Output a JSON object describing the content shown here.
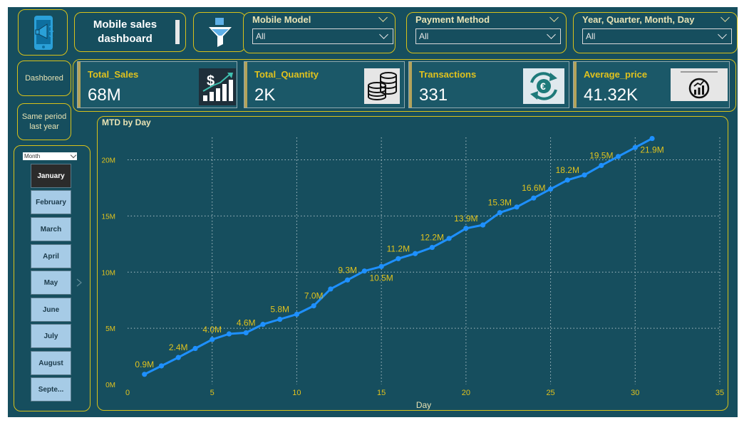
{
  "header": {
    "title": "Mobile sales dashboard",
    "slicers": [
      {
        "label": "Mobile Model",
        "value": "All"
      },
      {
        "label": "Payment Method",
        "value": "All"
      },
      {
        "label": "Year, Quarter, Month, Day",
        "value": "All"
      }
    ]
  },
  "nav": {
    "dashboard": "Dashbored",
    "same_period": "Same period last year"
  },
  "kpis": [
    {
      "title": "Total_Sales",
      "value": "68M",
      "icon": "dollar-growth-icon"
    },
    {
      "title": "Total_Quantity",
      "value": "2K",
      "icon": "coins-stack-icon"
    },
    {
      "title": "Transactions",
      "value": "331",
      "icon": "euro-exchange-icon"
    },
    {
      "title": "Average_price",
      "value": "41.32K",
      "icon": "coin-chart-icon"
    }
  ],
  "month_slicer": {
    "header": "Month",
    "items": [
      "January",
      "February",
      "March",
      "April",
      "May",
      "June",
      "July",
      "August",
      "Septe..."
    ],
    "selected": "January"
  },
  "colors": {
    "background": "#164e5e",
    "border": "#d8c21a",
    "line": "#1e90ff",
    "label": "#e0c21e"
  },
  "chart_data": {
    "type": "line",
    "title": "MTD by Day",
    "xlabel": "Day",
    "ylabel": "",
    "xlim": [
      0,
      35
    ],
    "ylim": [
      0,
      22000000
    ],
    "x_ticks": [
      0,
      5,
      10,
      15,
      20,
      25,
      30,
      35
    ],
    "y_ticks": [
      0,
      5000000,
      10000000,
      15000000,
      20000000
    ],
    "y_tick_labels": [
      "0M",
      "5M",
      "10M",
      "15M",
      "20M"
    ],
    "grid": true,
    "series": [
      {
        "name": "MTD",
        "x": [
          1,
          2,
          3,
          4,
          5,
          6,
          7,
          8,
          9,
          10,
          11,
          12,
          13,
          14,
          15,
          16,
          17,
          18,
          19,
          20,
          21,
          22,
          23,
          24,
          25,
          26,
          27,
          28,
          29,
          30,
          31
        ],
        "y": [
          900000,
          1650000,
          2400000,
          3200000,
          4000000,
          4500000,
          4600000,
          5350000,
          5800000,
          6250000,
          7000000,
          8500000,
          9300000,
          10100000,
          10500000,
          11200000,
          11650000,
          12200000,
          13000000,
          13900000,
          14200000,
          15300000,
          15800000,
          16600000,
          17400000,
          18200000,
          18650000,
          19500000,
          20300000,
          21100000,
          21900000
        ],
        "labels": [
          {
            "x": 1,
            "text": "0.9M",
            "pos": "above"
          },
          {
            "x": 3,
            "text": "2.4M",
            "pos": "above"
          },
          {
            "x": 5,
            "text": "4.0M",
            "pos": "above"
          },
          {
            "x": 7,
            "text": "4.6M",
            "pos": "above"
          },
          {
            "x": 9,
            "text": "5.8M",
            "pos": "above"
          },
          {
            "x": 11,
            "text": "7.0M",
            "pos": "above"
          },
          {
            "x": 13,
            "text": "9.3M",
            "pos": "above"
          },
          {
            "x": 15,
            "text": "10.5M",
            "pos": "below"
          },
          {
            "x": 16,
            "text": "11.2M",
            "pos": "above"
          },
          {
            "x": 18,
            "text": "12.2M",
            "pos": "above"
          },
          {
            "x": 20,
            "text": "13.9M",
            "pos": "above"
          },
          {
            "x": 22,
            "text": "15.3M",
            "pos": "above"
          },
          {
            "x": 24,
            "text": "16.6M",
            "pos": "above"
          },
          {
            "x": 26,
            "text": "18.2M",
            "pos": "above"
          },
          {
            "x": 28,
            "text": "19.5M",
            "pos": "above"
          },
          {
            "x": 31,
            "text": "21.9M",
            "pos": "below"
          }
        ]
      }
    ]
  }
}
